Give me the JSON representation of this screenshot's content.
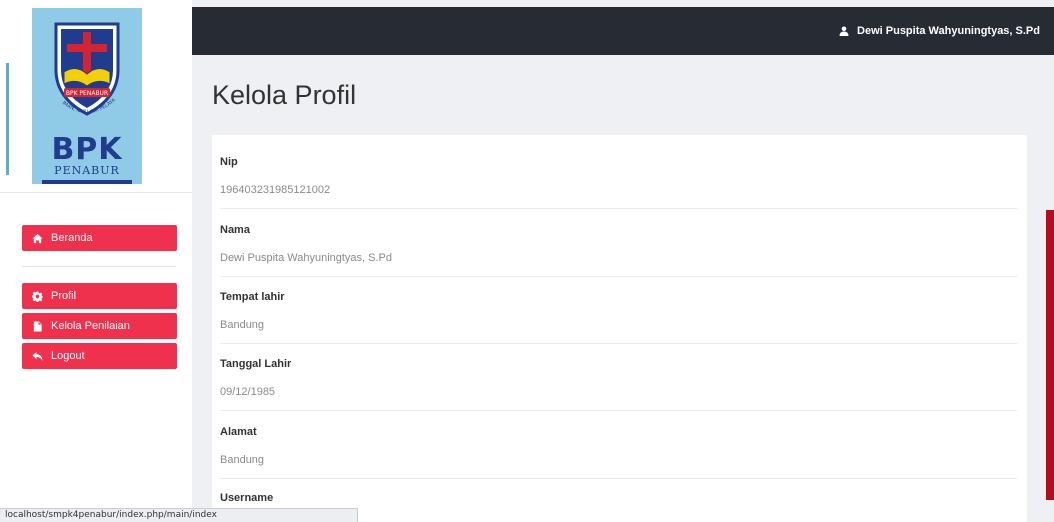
{
  "logo": {
    "brand_main": "BPK",
    "brand_sub": "PENABUR",
    "banner_text": "BPK PENABUR",
    "motto": "IMAN, ILMU dan PELAYANAN"
  },
  "topbar": {
    "user_name": "Dewi Puspita Wahyuningtyas, S.Pd",
    "user_icon": "user-icon"
  },
  "sidebar": {
    "items": [
      {
        "label": "Beranda",
        "icon": "home-icon"
      },
      {
        "label": "Profil",
        "icon": "gear-icon"
      },
      {
        "label": "Kelola Penilaian",
        "icon": "file-icon"
      },
      {
        "label": "Logout",
        "icon": "reply-icon"
      }
    ]
  },
  "page": {
    "title": "Kelola Profil"
  },
  "profile": {
    "fields": [
      {
        "label": "Nip",
        "value": "196403231985121002"
      },
      {
        "label": "Nama",
        "value": "Dewi Puspita Wahyuningtyas, S.Pd"
      },
      {
        "label": "Tempat lahir",
        "value": "Bandung"
      },
      {
        "label": "Tanggal Lahir",
        "value": "09/12/1985"
      },
      {
        "label": "Alamat",
        "value": "Bandung"
      },
      {
        "label": "Username",
        "value": ""
      }
    ]
  },
  "statusbar": {
    "url": "localhost/smpk4penabur/index.php/main/index"
  },
  "colors": {
    "accent": "#f0314e",
    "topbar": "#272b34",
    "logo_bg": "#8fcae6",
    "brand_blue": "#1f3c8f"
  }
}
